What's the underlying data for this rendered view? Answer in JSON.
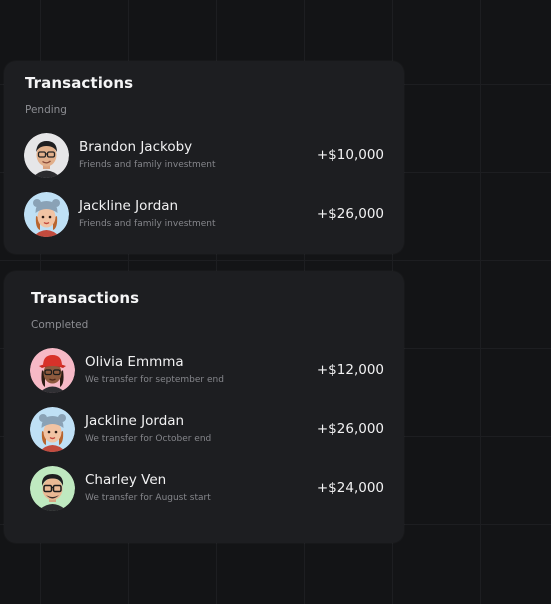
{
  "pending": {
    "title": "Transactions",
    "subtitle": "Pending",
    "items": [
      {
        "name": "Brandon Jackoby",
        "description": "Friends and family investment",
        "amount": "+$10,000",
        "avatar": "memoji-man-glasses-wink",
        "avatar_bg": "#e6e6e8"
      },
      {
        "name": "Jackline Jordan",
        "description": "Friends and family investment",
        "amount": "+$26,000",
        "avatar": "memoji-woman-bear-hat",
        "avatar_bg": "#bfe0f5"
      }
    ]
  },
  "completed": {
    "title": "Transactions",
    "subtitle": "Completed",
    "items": [
      {
        "name": "Olivia Emmma",
        "description": "We transfer for september end",
        "amount": "+$12,000",
        "avatar": "memoji-woman-red-hat",
        "avatar_bg": "#f6b9c6"
      },
      {
        "name": "Jackline Jordan",
        "description": "We transfer for October end",
        "amount": "+$26,000",
        "avatar": "memoji-woman-bear-hat",
        "avatar_bg": "#bfe0f5"
      },
      {
        "name": "Charley Ven",
        "description": "We transfer for August start",
        "amount": "+$24,000",
        "avatar": "memoji-man-glasses",
        "avatar_bg": "#bfe9c0"
      }
    ]
  },
  "colors": {
    "background": "#131416",
    "card": "#1d1e21",
    "text_primary": "#f2f2f3",
    "text_secondary": "#85868b"
  }
}
